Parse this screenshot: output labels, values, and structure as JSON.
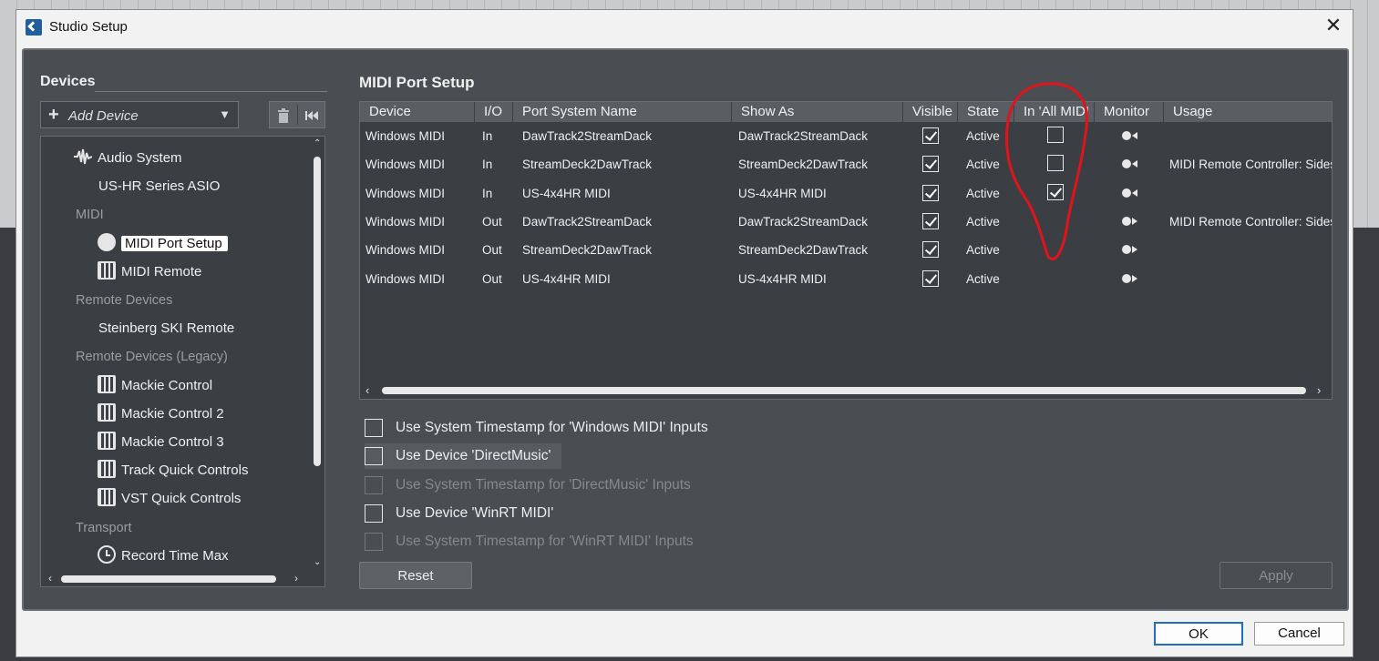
{
  "window": {
    "title": "Studio Setup"
  },
  "left": {
    "heading": "Devices",
    "add_device": "Add Device",
    "tree": [
      {
        "kind": "item",
        "label": "Audio System",
        "icon": "waveform-icon",
        "level": 1
      },
      {
        "kind": "item",
        "label": "US-HR Series ASIO",
        "icon": "",
        "level": 2
      },
      {
        "kind": "cat",
        "label": "MIDI"
      },
      {
        "kind": "item",
        "label": "MIDI Port Setup",
        "icon": "midi-din-icon",
        "level": 2,
        "selected": true
      },
      {
        "kind": "item",
        "label": "MIDI Remote",
        "icon": "piano-keys-icon",
        "level": 2
      },
      {
        "kind": "cat",
        "label": "Remote Devices"
      },
      {
        "kind": "item",
        "label": "Steinberg SKI Remote",
        "icon": "",
        "level": 2
      },
      {
        "kind": "cat",
        "label": "Remote Devices (Legacy)"
      },
      {
        "kind": "item",
        "label": "Mackie Control",
        "icon": "piano-keys-icon",
        "level": 2
      },
      {
        "kind": "item",
        "label": "Mackie Control 2",
        "icon": "piano-keys-icon",
        "level": 2
      },
      {
        "kind": "item",
        "label": "Mackie Control 3",
        "icon": "piano-keys-icon",
        "level": 2
      },
      {
        "kind": "item",
        "label": "Track Quick Controls",
        "icon": "piano-keys-icon",
        "level": 2
      },
      {
        "kind": "item",
        "label": "VST Quick Controls",
        "icon": "piano-keys-icon",
        "level": 2
      },
      {
        "kind": "cat",
        "label": "Transport"
      },
      {
        "kind": "item",
        "label": "Record Time Max",
        "icon": "clock-icon",
        "level": 2
      }
    ]
  },
  "main": {
    "heading": "MIDI Port Setup",
    "columns": [
      "Device",
      "I/O",
      "Port System Name",
      "Show As",
      "Visible",
      "State",
      "In 'All MIDI",
      "Monitor",
      "Usage"
    ],
    "rows": [
      {
        "device": "Windows MIDI",
        "io": "In",
        "port": "DawTrack2StreamDack",
        "show_as": "DawTrack2StreamDack",
        "visible": true,
        "state": "Active",
        "all_midi": false,
        "usage": ""
      },
      {
        "device": "Windows MIDI",
        "io": "In",
        "port": "StreamDeck2DawTrack",
        "show_as": "StreamDeck2DawTrack",
        "visible": true,
        "state": "Active",
        "all_midi": false,
        "usage": "MIDI Remote Controller: Sides"
      },
      {
        "device": "Windows MIDI",
        "io": "In",
        "port": "US-4x4HR MIDI",
        "show_as": "US-4x4HR MIDI",
        "visible": true,
        "state": "Active",
        "all_midi": true,
        "usage": ""
      },
      {
        "device": "Windows MIDI",
        "io": "Out",
        "port": "DawTrack2StreamDack",
        "show_as": "DawTrack2StreamDack",
        "visible": true,
        "state": "Active",
        "all_midi": null,
        "usage": "MIDI Remote Controller: Sides"
      },
      {
        "device": "Windows MIDI",
        "io": "Out",
        "port": "StreamDeck2DawTrack",
        "show_as": "StreamDeck2DawTrack",
        "visible": true,
        "state": "Active",
        "all_midi": null,
        "usage": ""
      },
      {
        "device": "Windows MIDI",
        "io": "Out",
        "port": "US-4x4HR MIDI",
        "show_as": "US-4x4HR MIDI",
        "visible": true,
        "state": "Active",
        "all_midi": null,
        "usage": ""
      }
    ],
    "options": [
      {
        "label": "Use System Timestamp for 'Windows MIDI' Inputs",
        "checked": false,
        "enabled": true
      },
      {
        "label": "Use Device 'DirectMusic'",
        "checked": false,
        "enabled": true,
        "highlight": true
      },
      {
        "label": "Use System Timestamp for 'DirectMusic' Inputs",
        "checked": false,
        "enabled": false
      },
      {
        "label": "Use Device 'WinRT MIDI'",
        "checked": false,
        "enabled": true
      },
      {
        "label": "Use System Timestamp for 'WinRT MIDI' Inputs",
        "checked": false,
        "enabled": false
      }
    ],
    "reset_label": "Reset",
    "apply_label": "Apply"
  },
  "footer": {
    "ok_label": "OK",
    "cancel_label": "Cancel"
  },
  "colors": {
    "panel": "#4a4d52",
    "list_bg": "#3b3e42",
    "header_bg": "#5a5d62",
    "ok_border": "#1f6fbf",
    "annotation": "#e0141b"
  }
}
